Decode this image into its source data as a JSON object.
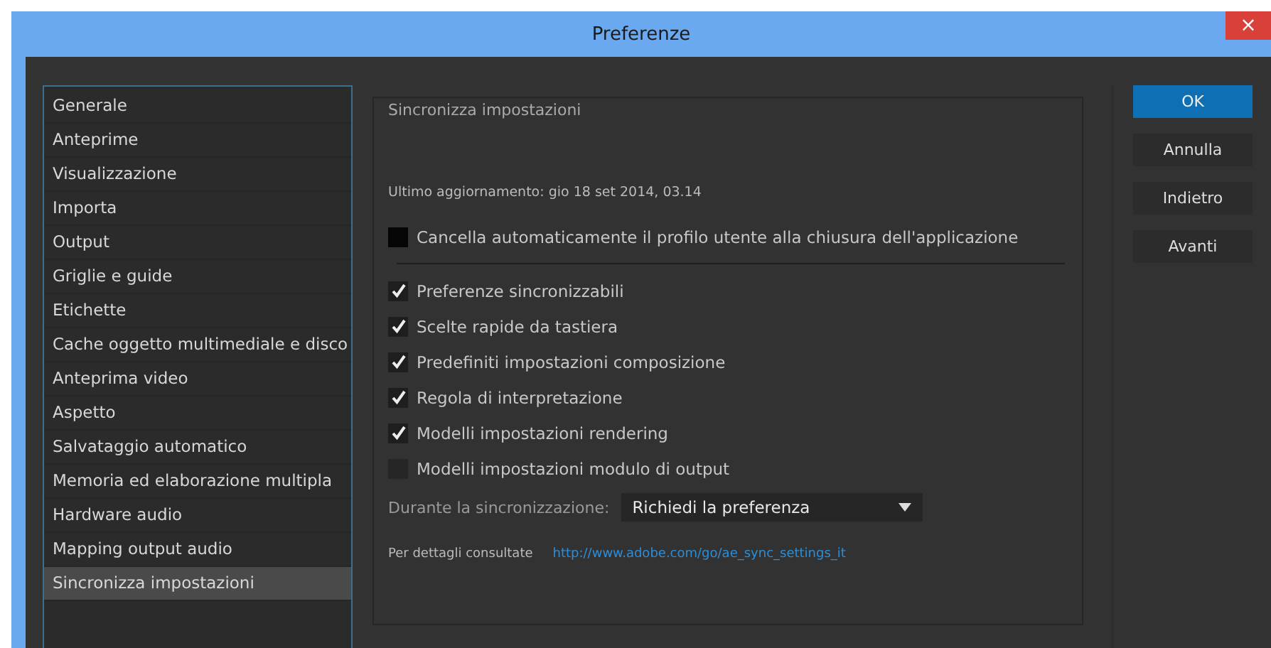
{
  "window": {
    "title": "Preferenze",
    "close": "×"
  },
  "sidebar": {
    "items": [
      {
        "label": "Generale",
        "selected": false
      },
      {
        "label": "Anteprime",
        "selected": false
      },
      {
        "label": "Visualizzazione",
        "selected": false
      },
      {
        "label": "Importa",
        "selected": false
      },
      {
        "label": "Output",
        "selected": false
      },
      {
        "label": "Griglie e guide",
        "selected": false
      },
      {
        "label": "Etichette",
        "selected": false
      },
      {
        "label": "Cache oggetto multimediale e disco",
        "selected": false
      },
      {
        "label": "Anteprima video",
        "selected": false
      },
      {
        "label": "Aspetto",
        "selected": false
      },
      {
        "label": "Salvataggio automatico",
        "selected": false
      },
      {
        "label": "Memoria ed elaborazione multipla",
        "selected": false
      },
      {
        "label": "Hardware audio",
        "selected": false
      },
      {
        "label": "Mapping output audio",
        "selected": false
      },
      {
        "label": "Sincronizza impostazioni",
        "selected": true
      }
    ]
  },
  "panel": {
    "title": "Sincronizza impostazioni",
    "last_update": "Ultimo aggiornamento: gio 18 set 2014, 03.14",
    "clear_profile": {
      "label": "Cancella automaticamente il profilo  utente alla chiusura dell'applicazione",
      "checked": false
    },
    "sync_items": [
      {
        "label": "Preferenze sincronizzabili",
        "checked": true
      },
      {
        "label": "Scelte rapide da tastiera",
        "checked": true
      },
      {
        "label": "Predefiniti impostazioni composizione",
        "checked": true
      },
      {
        "label": "Regola di interpretazione",
        "checked": true
      },
      {
        "label": "Modelli impostazioni rendering",
        "checked": true
      },
      {
        "label": "Modelli impostazioni modulo di output",
        "checked": false
      }
    ],
    "during_sync": {
      "label": "Durante la sincronizzazione:",
      "value": "Richiedi la preferenza"
    },
    "details": {
      "label": "Per dettagli consultate",
      "link": "http://www.adobe.com/go/ae_sync_settings_it"
    }
  },
  "buttons": [
    {
      "label": "OK",
      "primary": true
    },
    {
      "label": "Annulla",
      "primary": false
    },
    {
      "label": "Indietro",
      "primary": false
    },
    {
      "label": "Avanti",
      "primary": false
    }
  ]
}
